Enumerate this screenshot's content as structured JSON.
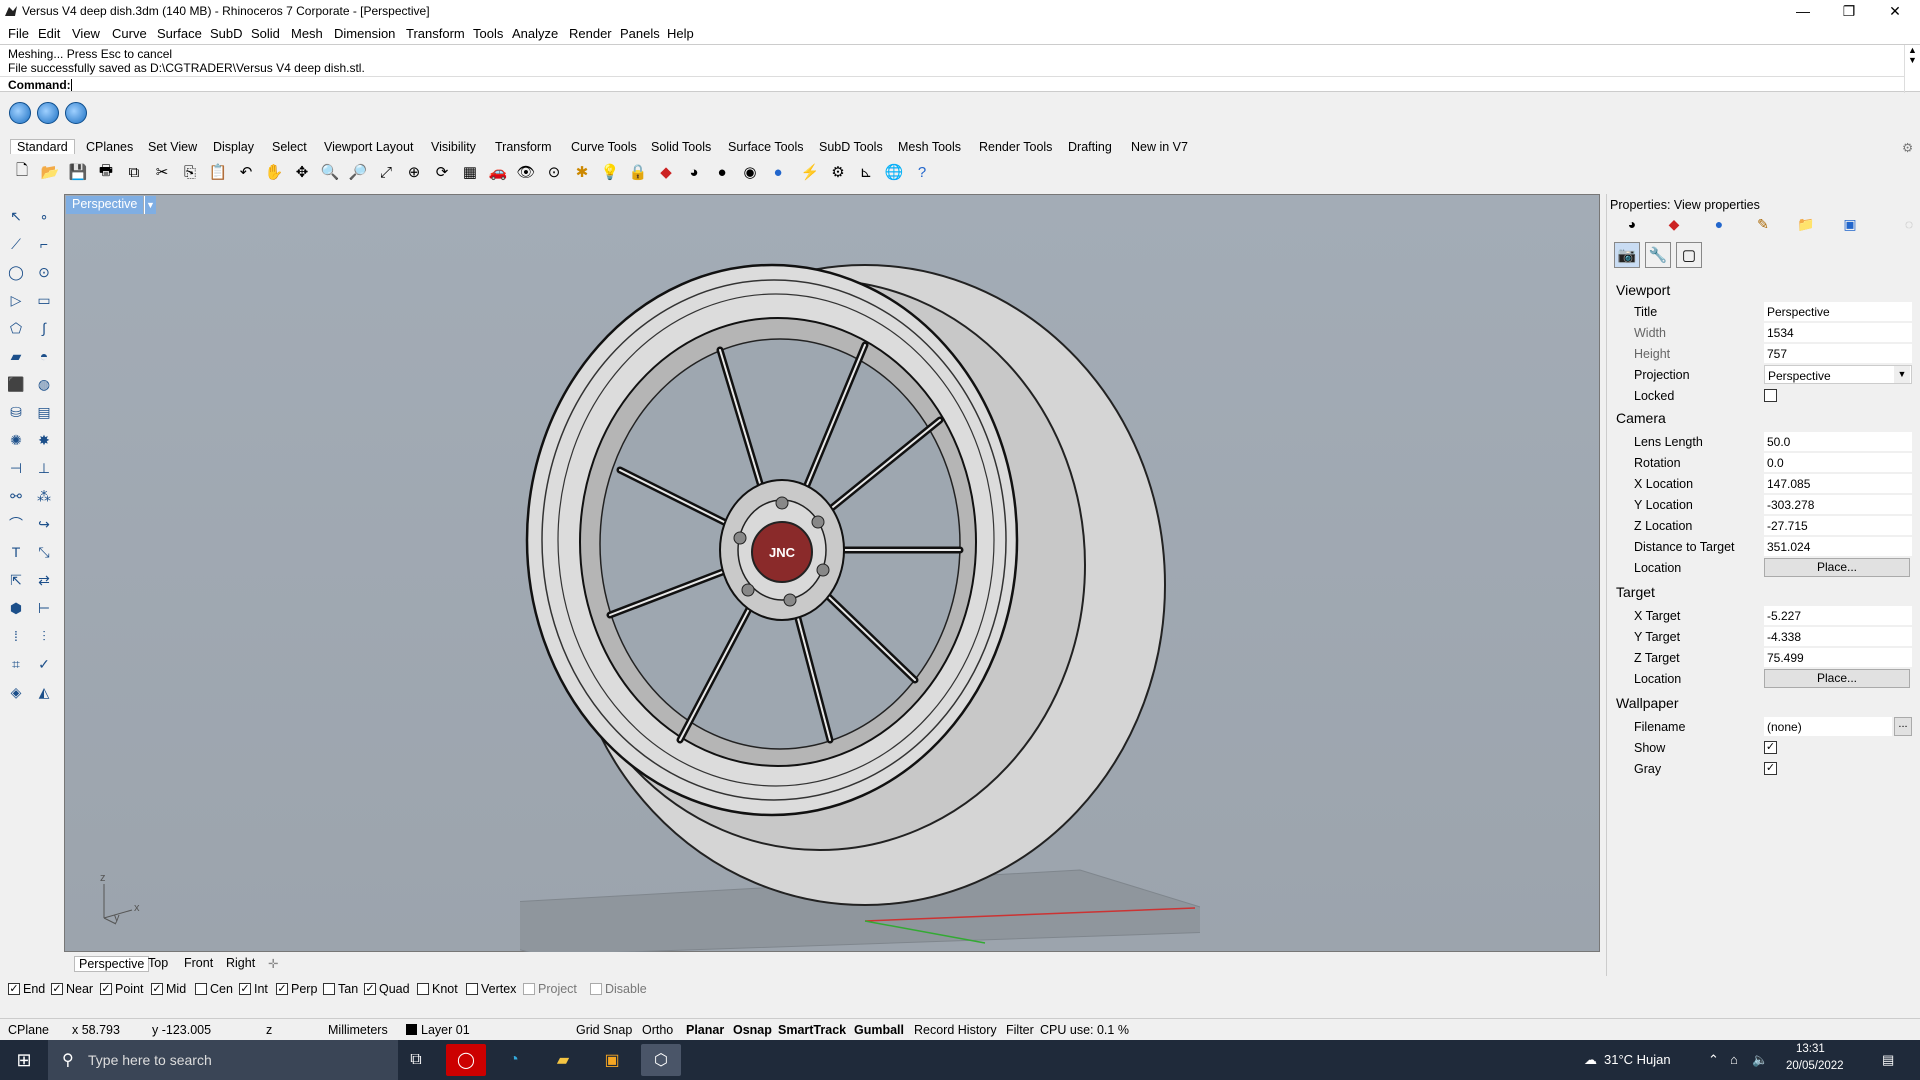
{
  "window": {
    "title": "Versus V4 deep dish.3dm (140 MB) - Rhinoceros 7 Corporate - [Perspective]",
    "controls": [
      "—",
      "❐",
      "✕"
    ]
  },
  "menu": [
    "File",
    "Edit",
    "View",
    "Curve",
    "Surface",
    "SubD",
    "Solid",
    "Mesh",
    "Dimension",
    "Transform",
    "Tools",
    "Analyze",
    "Render",
    "Panels",
    "Help"
  ],
  "command": {
    "history": [
      "Meshing... Press Esc to cancel",
      "File successfully saved as D:\\CGTRADER\\Versus V4 deep dish.stl."
    ],
    "prompt_label": "Command:",
    "value": ""
  },
  "toolbar_tabs": [
    "Standard",
    "CPlanes",
    "Set View",
    "Display",
    "Select",
    "Viewport Layout",
    "Visibility",
    "Transform",
    "Curve Tools",
    "Solid Tools",
    "Surface Tools",
    "SubD Tools",
    "Mesh Tools",
    "Render Tools",
    "Drafting",
    "New in V7"
  ],
  "active_tab": "Standard",
  "viewport": {
    "title": "Perspective",
    "axis": {
      "z": "z",
      "x": "x",
      "y": "y"
    },
    "badge_text": "JNC"
  },
  "viewport_tabs": [
    "Perspective",
    "Top",
    "Front",
    "Right"
  ],
  "osnaps": [
    {
      "label": "End",
      "checked": true
    },
    {
      "label": "Near",
      "checked": true
    },
    {
      "label": "Point",
      "checked": true
    },
    {
      "label": "Mid",
      "checked": true
    },
    {
      "label": "Cen",
      "checked": false
    },
    {
      "label": "Int",
      "checked": true
    },
    {
      "label": "Perp",
      "checked": true
    },
    {
      "label": "Tan",
      "checked": false
    },
    {
      "label": "Quad",
      "checked": true
    },
    {
      "label": "Knot",
      "checked": false
    },
    {
      "label": "Vertex",
      "checked": false
    },
    {
      "label": "Project",
      "checked": false
    },
    {
      "label": "Disable",
      "checked": false
    }
  ],
  "status": {
    "cplane": "CPlane",
    "x": "x 58.793",
    "y": "y -123.005",
    "z": "z",
    "units": "Millimeters",
    "layer": "Layer 01",
    "grid_snap": "Grid Snap",
    "ortho": "Ortho",
    "planar": "Planar",
    "osnap": "Osnap",
    "smarttrack": "SmartTrack",
    "gumball": "Gumball",
    "record": "Record History",
    "filter": "Filter",
    "cpu": "CPU use: 0.1 %"
  },
  "properties": {
    "title": "Properties: View properties",
    "sections": {
      "viewport": "Viewport",
      "camera": "Camera",
      "target": "Target",
      "wallpaper": "Wallpaper"
    },
    "viewport_rows": [
      {
        "label": "Title",
        "value": "Perspective"
      },
      {
        "label": "Width",
        "value": "1534"
      },
      {
        "label": "Height",
        "value": "757"
      },
      {
        "label": "Projection",
        "value": "Perspective"
      },
      {
        "label": "Locked",
        "value": ""
      }
    ],
    "camera_rows": [
      {
        "label": "Lens Length",
        "value": "50.0"
      },
      {
        "label": "Rotation",
        "value": "0.0"
      },
      {
        "label": "X Location",
        "value": "147.085"
      },
      {
        "label": "Y Location",
        "value": "-303.278"
      },
      {
        "label": "Z Location",
        "value": "-27.715"
      },
      {
        "label": "Distance to Target",
        "value": "351.024"
      },
      {
        "label": "Location",
        "value": "Place..."
      }
    ],
    "target_rows": [
      {
        "label": "X Target",
        "value": "-5.227"
      },
      {
        "label": "Y Target",
        "value": "-4.338"
      },
      {
        "label": "Z Target",
        "value": "75.499"
      },
      {
        "label": "Location",
        "value": "Place..."
      }
    ],
    "wallpaper_rows": [
      {
        "label": "Filename",
        "value": "(none)"
      },
      {
        "label": "Show",
        "value": "✓"
      },
      {
        "label": "Gray",
        "value": "✓"
      }
    ],
    "browse": "..."
  },
  "taskbar": {
    "search_placeholder": "Type here to search",
    "weather": "31°C  Hujan",
    "time": "13:31",
    "date": "20/05/2022"
  }
}
